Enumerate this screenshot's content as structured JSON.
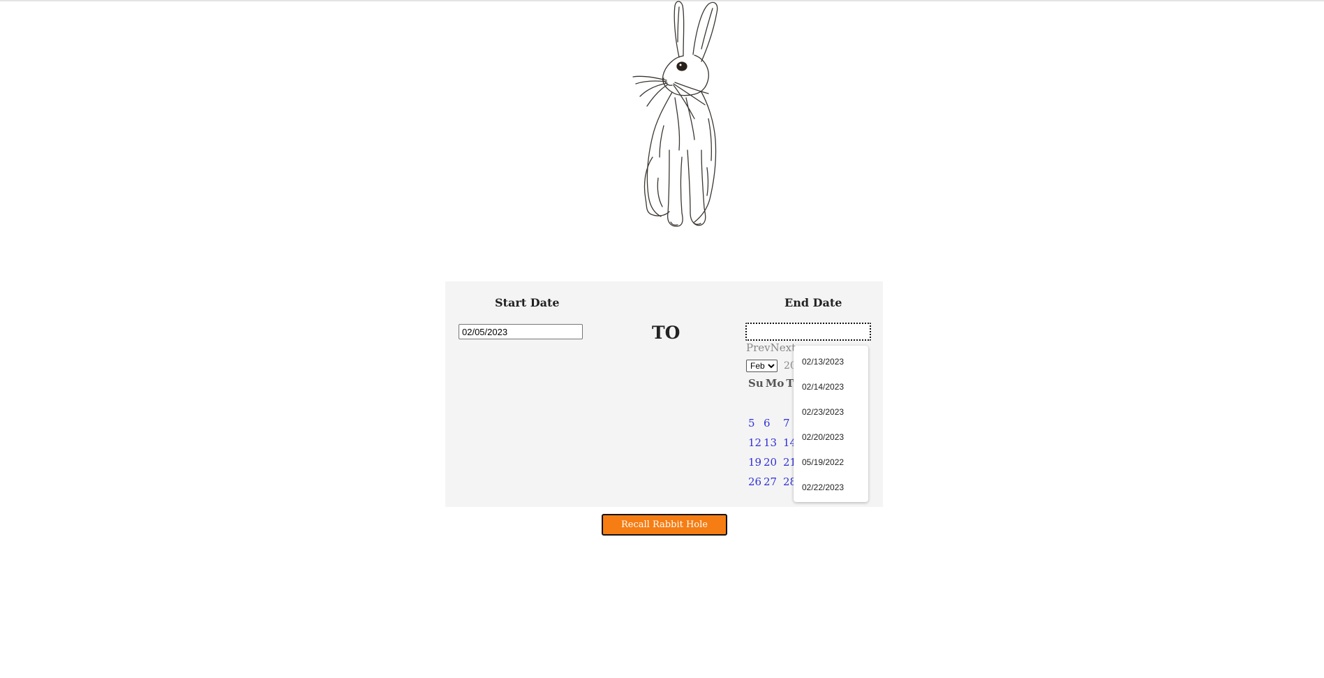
{
  "form": {
    "start_label": "Start Date",
    "end_label": "End Date",
    "start_value": "02/05/2023",
    "end_value": "",
    "separator": "TO"
  },
  "datepicker": {
    "prev_label": "Prev",
    "next_label": "Next",
    "selected_month": "Feb",
    "year_partial": "20",
    "weekday_headers": [
      "Su",
      "Mo",
      "Tu"
    ],
    "week_rows": [
      [
        "5",
        "6",
        "7"
      ],
      [
        "12",
        "13",
        "14"
      ],
      [
        "19",
        "20",
        "21"
      ],
      [
        "26",
        "27",
        "28"
      ]
    ]
  },
  "autocomplete": {
    "options": [
      "02/13/2023",
      "02/14/2023",
      "02/23/2023",
      "02/20/2023",
      "05/19/2022",
      "02/22/2023"
    ]
  },
  "actions": {
    "recall_label": "Recall Rabbit Hole"
  },
  "colors": {
    "accent": "#f57d13",
    "day_link": "#2f2fd8",
    "panel_bg": "#f4f4f4"
  }
}
